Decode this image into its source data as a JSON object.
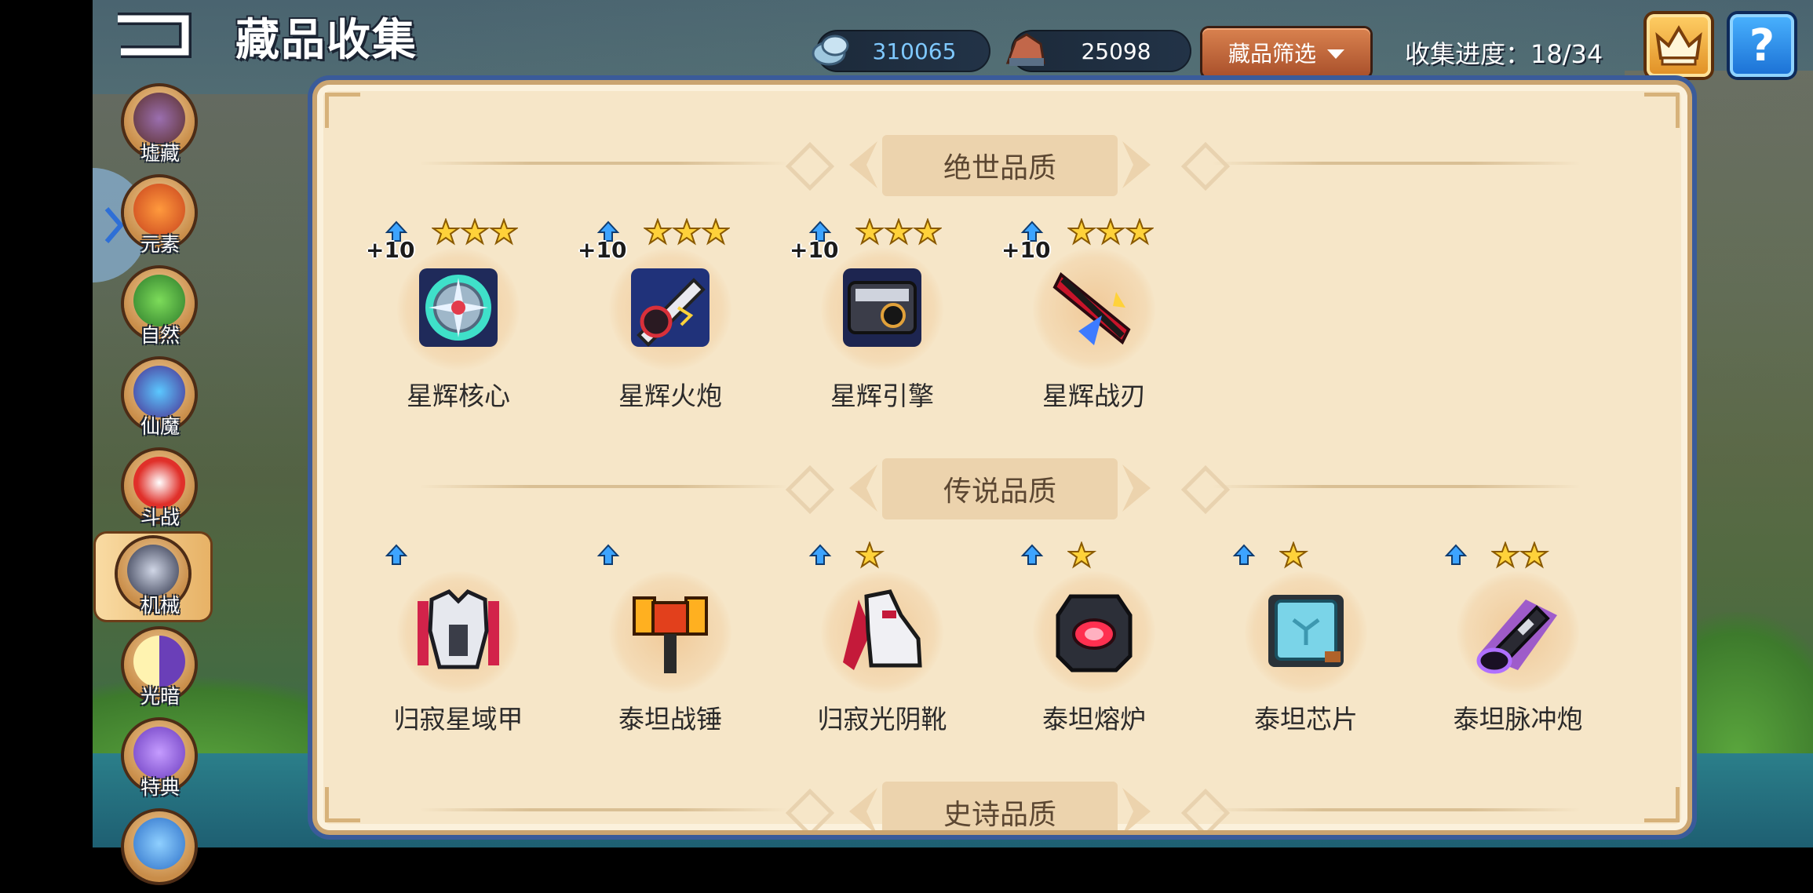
{
  "header": {
    "title": "藏品收集",
    "currency_1": "310065",
    "currency_2": "25098",
    "filter_label": "藏品筛选",
    "progress_text": "收集进度：18/34",
    "help_label": "?"
  },
  "sidebar": {
    "items": [
      {
        "label": "墟藏"
      },
      {
        "label": "元素"
      },
      {
        "label": "自然"
      },
      {
        "label": "仙魔"
      },
      {
        "label": "斗战"
      },
      {
        "label": "机械"
      },
      {
        "label": "光暗"
      },
      {
        "label": "特典"
      }
    ],
    "active": "机械"
  },
  "sections": [
    {
      "title": "绝世品质",
      "items": [
        {
          "name": "星辉核心",
          "level": "+10",
          "stars": 3
        },
        {
          "name": "星辉火炮",
          "level": "+10",
          "stars": 3
        },
        {
          "name": "星辉引擎",
          "level": "+10",
          "stars": 3
        },
        {
          "name": "星辉战刃",
          "level": "+10",
          "stars": 3
        }
      ]
    },
    {
      "title": "传说品质",
      "items": [
        {
          "name": "归寂星域甲",
          "stars": 0
        },
        {
          "name": "泰坦战锤",
          "stars": 0
        },
        {
          "name": "归寂光阴靴",
          "stars": 1
        },
        {
          "name": "泰坦熔炉",
          "stars": 1
        },
        {
          "name": "泰坦芯片",
          "stars": 1
        },
        {
          "name": "泰坦脉冲炮",
          "stars": 2
        }
      ]
    },
    {
      "title": "史诗品质"
    }
  ],
  "colors": {
    "accent_orange": "#c9713f",
    "panel_bg": "#f6e6c8",
    "frame_blue": "#3a5b9a",
    "star_gold": "#ffd23a",
    "upgrade_blue": "#3da4ff"
  }
}
